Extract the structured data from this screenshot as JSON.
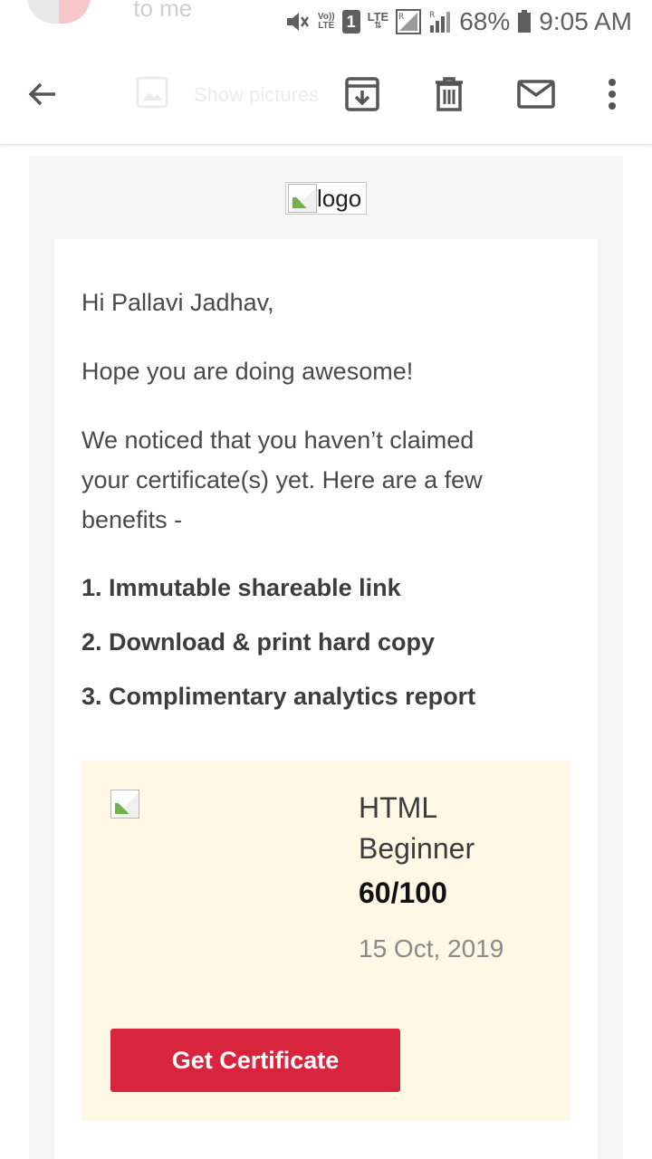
{
  "status_bar": {
    "ghost_text": "to me",
    "network_top": "Vo))",
    "network_bottom": "LTE",
    "sim": "1",
    "lte": "LTE",
    "roaming": "R",
    "battery": "68%",
    "time": "9:05 AM"
  },
  "toolbar": {
    "show_pictures": "Show pictures"
  },
  "email": {
    "logo_alt": "logo",
    "greeting": "Hi Pallavi Jadhav,",
    "line1": "Hope you are doing awesome!",
    "line2a": "We noticed that you haven’t claimed",
    "line2b": "your certificate(s) yet. Here are a few",
    "line2c": "benefits -",
    "benefits": [
      "1. Immutable shareable link",
      "2. Download & print hard copy",
      "3. Complimentary analytics report"
    ],
    "certificate": {
      "title_line1": "HTML",
      "title_line2": "Beginner",
      "score": "60/100",
      "date": "15 Oct, 2019",
      "button": "Get Certificate"
    }
  },
  "colors": {
    "accent": "#d9243e",
    "card_bg": "#fff8e5",
    "outer_bg": "#f6f6f6"
  }
}
